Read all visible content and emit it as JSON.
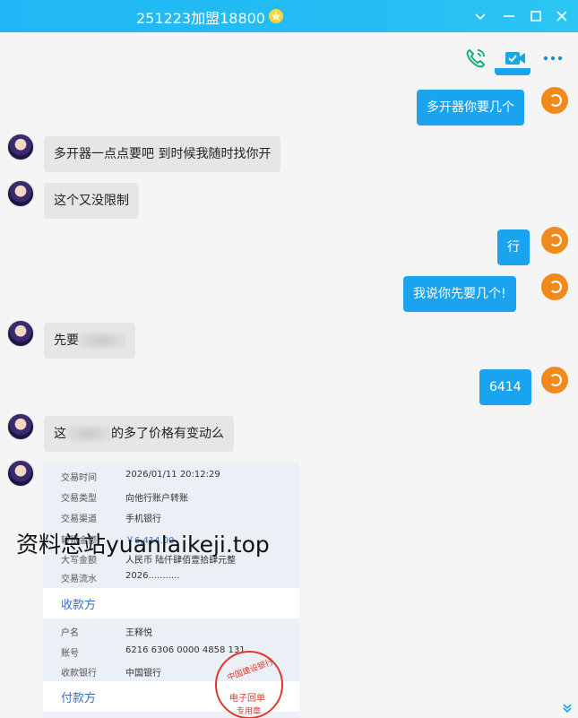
{
  "window": {
    "title": "251223加盟18800",
    "badge_icon": "star-badge-icon",
    "controls": [
      "chevron-down-icon",
      "minimize-icon",
      "maximize-icon",
      "close-icon"
    ]
  },
  "toolbar": {
    "icons": [
      "voice-call-icon",
      "video-call-icon",
      "more-icon"
    ]
  },
  "messages": [
    {
      "side": "out",
      "text": "多开器你要几个"
    },
    {
      "side": "in",
      "text": "多开器一点点要吧   到时候我随时找你开"
    },
    {
      "side": "in",
      "text": "这个又没限制"
    },
    {
      "side": "out",
      "text": "行"
    },
    {
      "side": "out",
      "text": "我说你先要几个!"
    },
    {
      "side": "in",
      "text": "先要"
    },
    {
      "side": "out",
      "text": "6414"
    },
    {
      "side": "in",
      "text_before": "这",
      "text_after": "的多了价格有变动么"
    }
  ],
  "receipt": {
    "rows": [
      {
        "label": "交易时间",
        "value": "2026/01/11 20:12:29"
      },
      {
        "label": "交易类型",
        "value": "向他行账户转账"
      },
      {
        "label": "交易渠道",
        "value": "手机银行"
      },
      {
        "label": "转账金额",
        "value": "￥6,414.00"
      },
      {
        "label": "大写金额",
        "value": "人民币 陆仟肆佰壹拾肆元整"
      },
      {
        "label": "交易流水",
        "value": "2026..........."
      }
    ],
    "payee_title": "收款方",
    "payee_rows": [
      {
        "label": "户名",
        "value": "王释悦"
      },
      {
        "label": "账号",
        "value": "6216 6306 0000 4858 131"
      },
      {
        "label": "收款银行",
        "value": "中国银行"
      }
    ],
    "payer_title": "付款方",
    "stamp_lines": [
      "中国建设银行",
      "电子回单",
      "专用章"
    ]
  },
  "watermark": "资料总站yuanlaikeji.top",
  "colors": {
    "titlebar": "#24bdf4",
    "bubble_out": "#1aa4f0",
    "bubble_in": "#e6e6e6",
    "my_avatar": "#f08a1c"
  }
}
